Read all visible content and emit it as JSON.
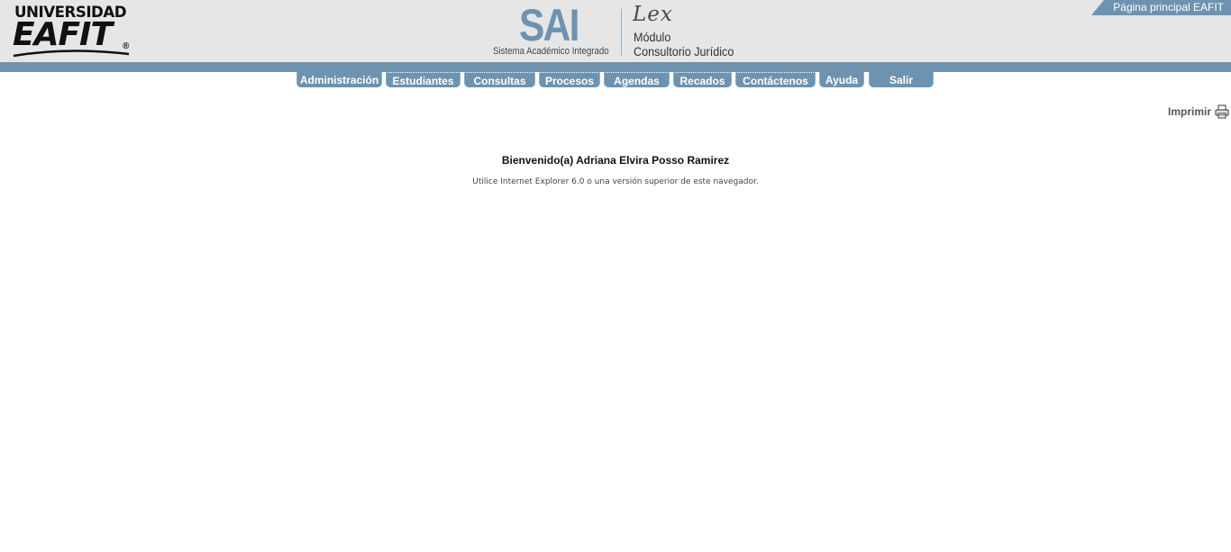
{
  "header": {
    "eafit_logo": {
      "line1": "UNIVERSIDAD",
      "line2": "EAFIT",
      "registered": "®"
    },
    "sai_logo": {
      "word": "SAI",
      "subtitle": "Sistema Académico Integrado"
    },
    "lex_logo": {
      "word": "Lex",
      "line1": "Módulo",
      "line2": "Consultorio Jurídico"
    },
    "home_link": "Página principal EAFIT",
    "colors": {
      "accent": "#6e93b0",
      "header_bg": "#e6e6e6"
    }
  },
  "nav": {
    "items": [
      {
        "label": "Administración"
      },
      {
        "label": "Estudiantes"
      },
      {
        "label": "Consultas"
      },
      {
        "label": "Procesos"
      },
      {
        "label": "Agendas"
      },
      {
        "label": "Recados"
      },
      {
        "label": "Contáctenos"
      },
      {
        "label": "Ayuda"
      },
      {
        "label": "Salir"
      }
    ]
  },
  "print": {
    "label": "Imprimir",
    "icon": "printer-icon"
  },
  "main": {
    "welcome": "Bienvenido(a) Adriana Elvira Posso Ramirez",
    "browser_note": "Utilice Internet Explorer 6.0 o una versión superior de este navegador."
  }
}
